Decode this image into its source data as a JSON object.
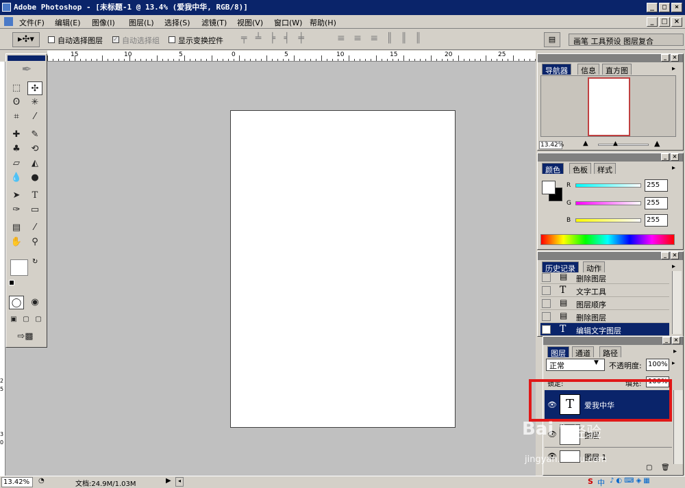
{
  "window": {
    "title": "Adobe Photoshop - [未标题-1 @ 13.4% (爱我中华, RGB/8)]",
    "btn_min": "_",
    "btn_max": "□",
    "btn_close": "×"
  },
  "menu": [
    "文件(F)",
    "编辑(E)",
    "图像(I)",
    "图层(L)",
    "选择(S)",
    "滤镜(T)",
    "视图(V)",
    "窗口(W)",
    "帮助(H)"
  ],
  "options": {
    "auto_select_layer": "自动选择图层",
    "auto_select_group": "自动选择组",
    "show_transform": "显示变换控件",
    "group_tabs": "画笔 工具预设 图层复合"
  },
  "ruler_h": [
    "15",
    "10",
    "5",
    "0",
    "5",
    "10",
    "15",
    "20",
    "25"
  ],
  "ruler_v": [
    "2",
    "5",
    "3",
    "0"
  ],
  "navigator": {
    "tabs": [
      "导航器",
      "信息",
      "直方图"
    ],
    "zoom": "13.42%"
  },
  "color": {
    "tabs": [
      "颜色",
      "色板",
      "样式"
    ],
    "r_label": "R",
    "g_label": "G",
    "b_label": "B",
    "r": "255",
    "g": "255",
    "b": "255"
  },
  "history": {
    "tabs": [
      "历史记录",
      "动作"
    ],
    "items": [
      "删除图层",
      "文字工具",
      "图层顺序",
      "删除图层",
      "编辑文字图层"
    ]
  },
  "layers": {
    "tabs": [
      "图层",
      "通道",
      "路径"
    ],
    "blend_mode": "正常",
    "opacity_label": "不透明度:",
    "opacity": "100%",
    "lock_label": "锁定:",
    "fill_label": "填充:",
    "fill": "100%",
    "items": [
      {
        "name": "爱我中华",
        "thumb": "T"
      },
      {
        "name": "图层",
        "thumb": ""
      },
      {
        "name": "图层 1",
        "thumb": ""
      }
    ]
  },
  "status": {
    "zoom": "13.42%",
    "doc": "文档:24.9M/1.03M"
  },
  "watermark": {
    "brand": "Bai",
    "text": "经验",
    "url": "jingyan.baidu.com"
  },
  "colors": {
    "title_bg": "#0a246a",
    "highlight": "#0a246a",
    "chrome": "#d4d0c8",
    "canvas_bg": "#c0c0c0",
    "annotation": "#e01818"
  }
}
